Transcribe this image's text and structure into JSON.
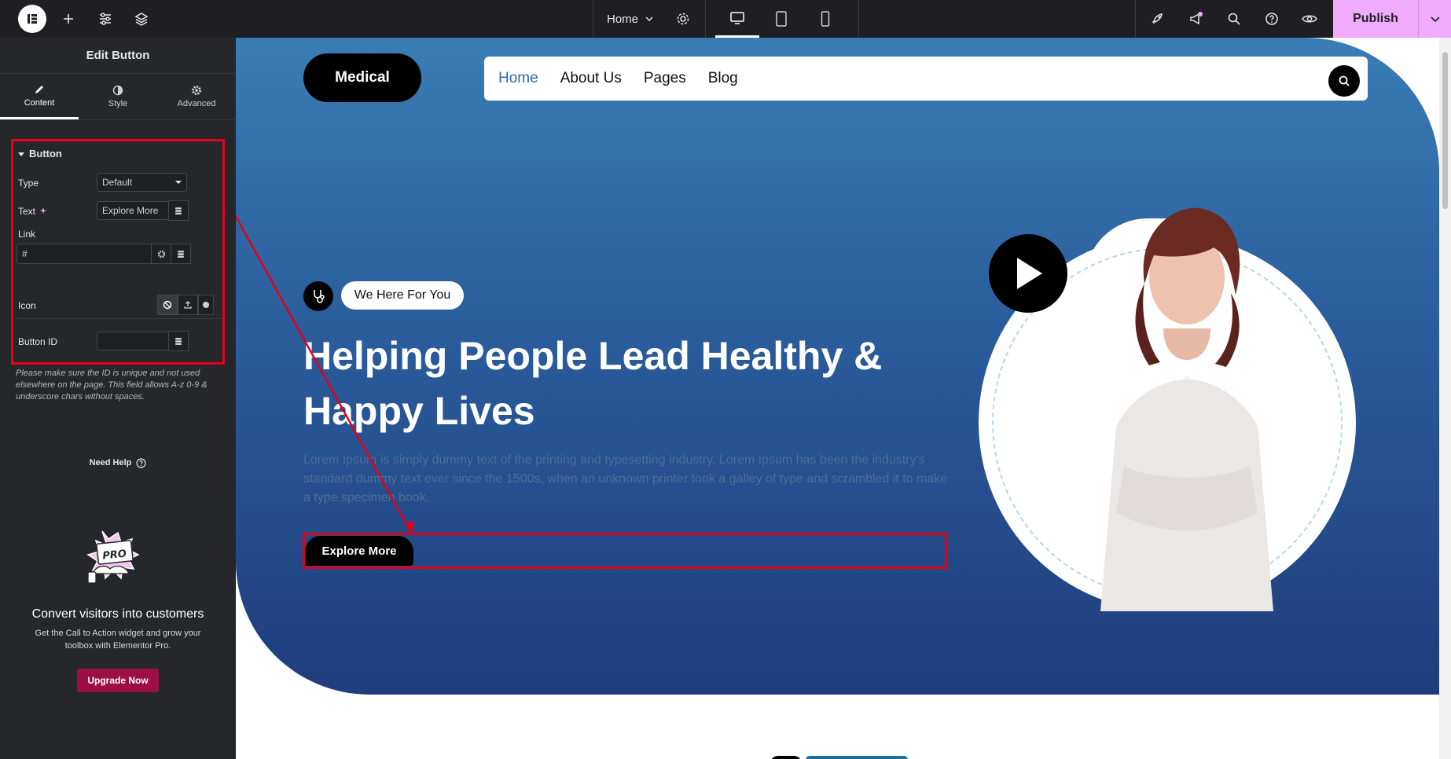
{
  "topbar": {
    "page_name": "Home",
    "publish_label": "Publish"
  },
  "panel": {
    "title": "Edit Button",
    "tabs": [
      {
        "label": "Content"
      },
      {
        "label": "Style"
      },
      {
        "label": "Advanced"
      }
    ],
    "section_title": "Button",
    "fields": {
      "type_label": "Type",
      "type_value": "Default",
      "text_label": "Text",
      "text_value": "Explore More",
      "link_label": "Link",
      "link_value": "#",
      "icon_label": "Icon",
      "button_id_label": "Button ID",
      "button_id_value": ""
    },
    "hint": "Please make sure the ID is unique and not used elsewhere on the page. This field allows A-z 0-9 & underscore chars without spaces.",
    "help_label": "Need Help",
    "promo": {
      "badge": "PRO",
      "title": "Convert visitors into customers",
      "text": "Get the Call to Action widget and grow your toolbox with Elementor Pro.",
      "button": "Upgrade Now"
    }
  },
  "canvas": {
    "brand": "Medical",
    "nav": [
      "Home",
      "About Us",
      "Pages",
      "Blog"
    ],
    "badge": "We Here For You",
    "headline": "Helping People Lead Healthy & Happy Lives",
    "lorem": "Lorem Ipsum is simply dummy text of the printing and typesetting industry. Lorem Ipsum has been the industry's standard dummy text ever since the 1500s, when an unknown printer took a galley of type and scrambled it to make a type specimen book.",
    "button": "Explore More"
  },
  "colors": {
    "publish": "#f0abfc",
    "highlight": "#e3001b",
    "upgrade": "#9d0e45",
    "hero_top": "#3a7db5",
    "hero_bottom": "#1f3d7c"
  }
}
